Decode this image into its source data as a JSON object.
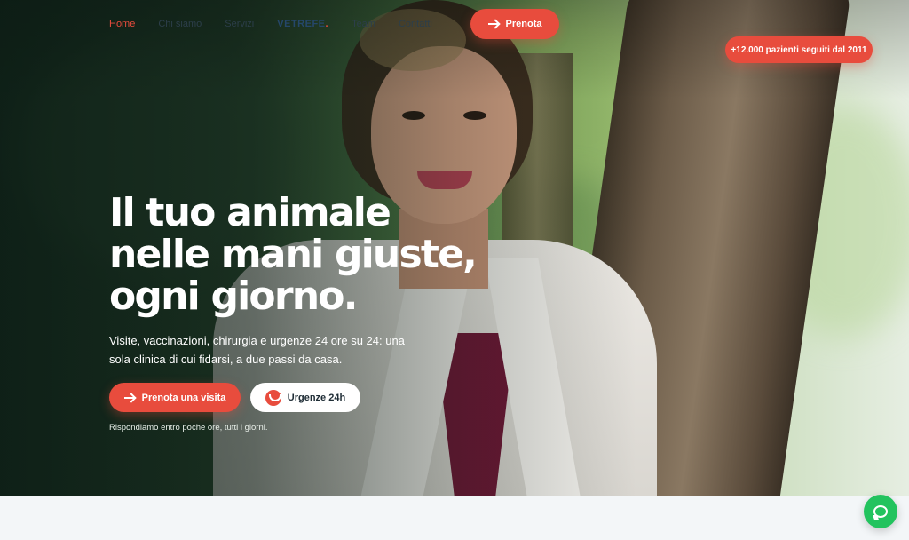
{
  "nav": {
    "items": [
      {
        "label": "Home",
        "active": true
      },
      {
        "label": "Chi siamo",
        "active": false
      },
      {
        "label": "Servizi",
        "active": false
      }
    ],
    "logo": "VETREFE",
    "items_right": [
      {
        "label": "Team"
      },
      {
        "label": "Contatti"
      }
    ],
    "cta_label": "Prenota"
  },
  "badge": {
    "label": "+12.000 pazienti seguiti dal 2011"
  },
  "hero": {
    "headline_lines": [
      "Il tuo animale",
      "nelle mani giuste,",
      "ogni giorno."
    ],
    "subtitle": "Visite, vaccinazioni, chirurgia e urgenze 24 ore su 24: una sola clinica di cui fidarsi, a due passi da casa.",
    "primary_button": "Prenota una visita",
    "secondary_button": "Urgenze 24h",
    "note": "Rispondiamo entro poche ore, tutti i giorni."
  },
  "colors": {
    "accent": "#e84c3d",
    "chat": "#22c35e"
  },
  "icons": {
    "arrow": "arrow-right-icon",
    "urgency": "emergency-icon",
    "chat": "chat-icon"
  }
}
